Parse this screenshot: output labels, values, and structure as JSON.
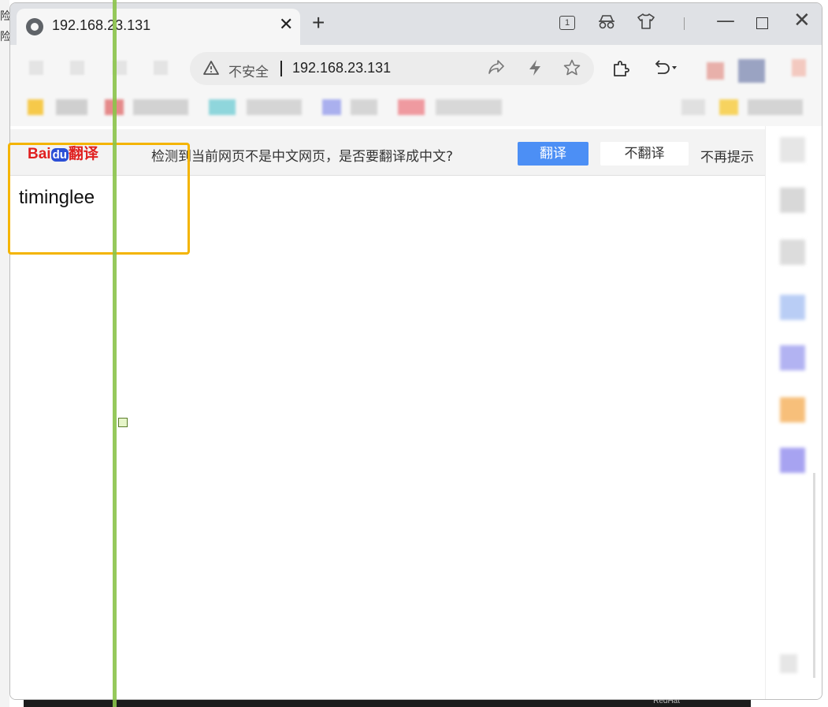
{
  "desktop": {
    "left_text": [
      "险",
      "险"
    ],
    "bottom_text": "RedHat"
  },
  "browser": {
    "tab": {
      "title": "192.168.23.131",
      "close": "✕"
    },
    "new_tab": "+",
    "tab_count": "1",
    "window_controls": {
      "minimize": "—",
      "maximize": "",
      "close": "✕"
    },
    "address": {
      "security_label": "不安全",
      "url": "192.168.23.131"
    }
  },
  "translate_bar": {
    "logo_bai": "Bai",
    "logo_du": "du",
    "logo_fanyi": "翻译",
    "message": "检测到当前网页不是中文网页，是否要翻译成中文?",
    "translate_button": "翻译",
    "no_translate_button": "不翻译",
    "never_button": "不再提示"
  },
  "page": {
    "text": "timinglee"
  },
  "icons": {
    "favicon": "browser-logo-icon",
    "share": "share-icon",
    "lightning": "lightning-icon",
    "star": "star-icon",
    "extensions": "puzzle-icon",
    "undo": "undo-icon",
    "incognito": "incognito-icon",
    "skin": "shirt-icon",
    "warning": "warning-icon"
  },
  "colors": {
    "accent_blue": "#4c8ff5",
    "highlight": "#f4b400",
    "guide_line": "#8bc34a",
    "baidu_red": "#e02020"
  }
}
